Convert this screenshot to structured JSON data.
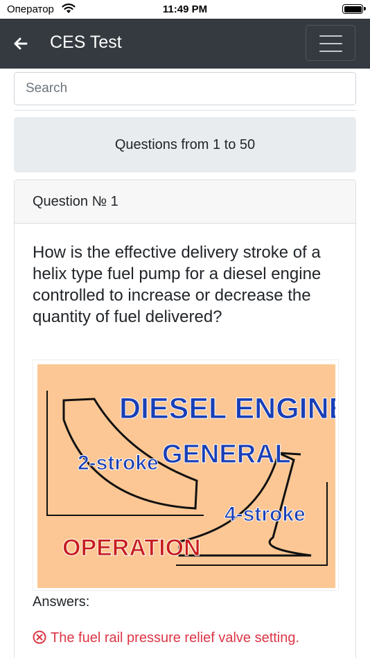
{
  "status_bar": {
    "carrier": "Оператор",
    "time": "11:49 PM"
  },
  "navbar": {
    "title": "CES Test",
    "back_icon": "arrow-left-icon",
    "menu_icon": "hamburger-menu-icon"
  },
  "search": {
    "placeholder": "Search",
    "value": ""
  },
  "range": {
    "label": "Questions from 1 to 50"
  },
  "question_card": {
    "header": "Question № 1",
    "text": "How is the effective delivery stroke of a helix type fuel pump for a diesel engine controlled to increase or decrease the quantity of fuel delivered?",
    "image": {
      "title": "DIESEL ENGINES",
      "subtitle": "GENERAL",
      "label_left": "2-stroke",
      "label_right": "4-stroke",
      "label_bottom": "OPERATION"
    },
    "answers_label": "Answers:",
    "answers": [
      {
        "text": "The fuel rail pressure relief valve setting.",
        "status": "incorrect",
        "icon": "x-circle-icon"
      }
    ]
  },
  "colors": {
    "navbar": "#343a40",
    "range_bg": "#e9ecef",
    "incorrect": "#dc3545",
    "illustration_bg": "#fcc794"
  }
}
